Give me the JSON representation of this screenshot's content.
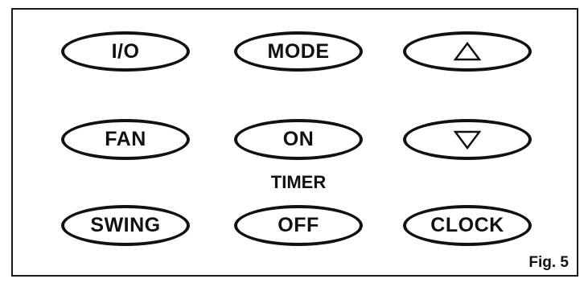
{
  "buttons": {
    "power": "I/O",
    "mode": "MODE",
    "fan": "FAN",
    "timer_on": "ON",
    "swing": "SWING",
    "timer_off": "OFF",
    "clock": "CLOCK"
  },
  "icons": {
    "up": "triangle-up-icon",
    "down": "triangle-down-icon"
  },
  "timer_label": "TIMER",
  "figure_label": "Fig. 5"
}
